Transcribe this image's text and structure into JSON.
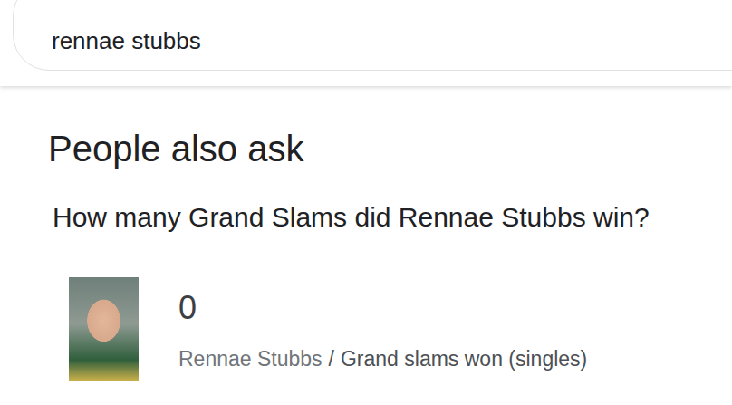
{
  "search": {
    "query": "rennae stubbs"
  },
  "section": {
    "title": "People also ask"
  },
  "question": {
    "text": "How many Grand Slams did Rennae Stubbs win?"
  },
  "answer": {
    "value": "0",
    "entity": "Rennae Stubbs",
    "separator": "/",
    "attribute": "Grand slams won (singles)"
  }
}
